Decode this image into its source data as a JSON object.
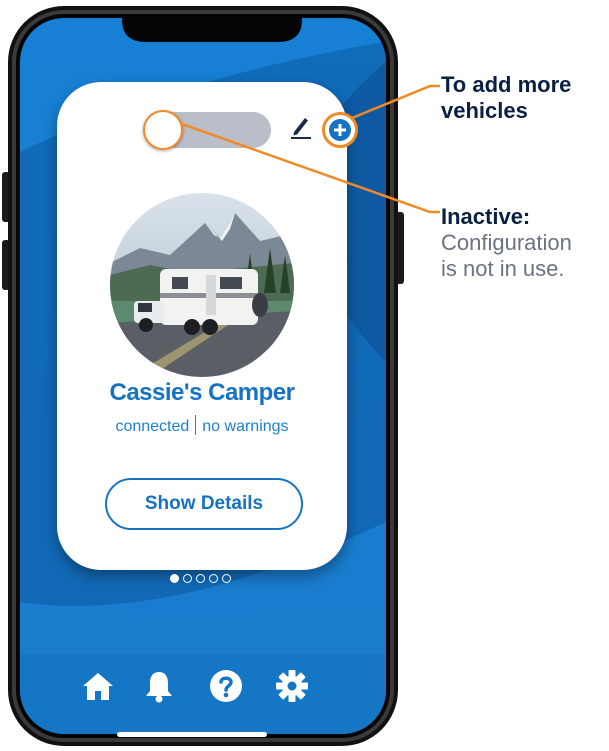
{
  "card": {
    "vehicle_name": "Cassie's Camper",
    "status_connection": "connected",
    "status_warnings": "no warnings",
    "details_button": "Show Details",
    "toggle_active": false
  },
  "pagination": {
    "total": 5,
    "current": 1
  },
  "tabbar": {
    "icons": [
      "home-icon",
      "bell-icon",
      "help-icon",
      "gear-icon"
    ]
  },
  "annotations": {
    "add_vehicles": "To add more vehicles",
    "inactive_title": "Inactive:",
    "inactive_body_line1": "Configuration",
    "inactive_body_line2": "is not in use."
  },
  "colors": {
    "brand_blue": "#1672c3",
    "screen_blue": "#1a7fd0",
    "accent_orange": "#f08a24",
    "annotation_text": "#0a1f44"
  }
}
